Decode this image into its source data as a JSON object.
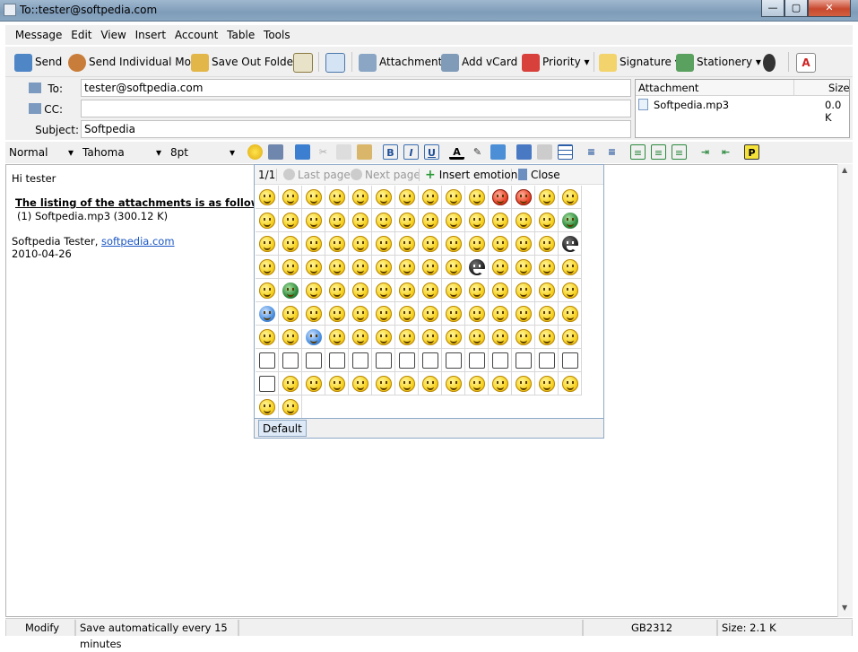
{
  "window": {
    "title": "To::tester@softpedia.com"
  },
  "menu": [
    "Message",
    "Edit",
    "View",
    "Insert",
    "Account",
    "Table",
    "Tools"
  ],
  "toolbar": {
    "send": "Send",
    "send_individual": "Send Individual Mode",
    "save_out": "Save Out Folder",
    "attachment": "Attachment",
    "add_vcard": "Add vCard",
    "priority": "Priority",
    "signature": "Signature",
    "stationery": "Stationery"
  },
  "header": {
    "to_label": "To:",
    "to_value": "tester@softpedia.com",
    "cc_label": "CC:",
    "cc_value": "",
    "subject_label": "Subject:",
    "subject_value": "Softpedia"
  },
  "attachments": {
    "col_name": "Attachment",
    "col_size": "Size",
    "rows": [
      {
        "name": "Softpedia.mp3",
        "size": "0.0 K"
      }
    ]
  },
  "format": {
    "style": "Normal",
    "font": "Tahoma",
    "size": "8pt",
    "bold": "B",
    "italic": "I",
    "underline": "U"
  },
  "body": {
    "greeting": "Hi tester",
    "listing_heading": "The listing of the attachments is as following:",
    "listing_item": "(1) Softpedia.mp3 (300.12 K)",
    "signature_name": "Softpedia Tester, ",
    "signature_link": "softpedia.com",
    "date": "2010-04-26"
  },
  "emoticons": {
    "page": "1/1",
    "last_page": "Last page",
    "next_page": "Next page",
    "insert": "Insert emotion",
    "close": "Close",
    "tab": "Default",
    "count": 128
  },
  "status": {
    "mode": "Modify",
    "autosave": "Save automatically every 15 minutes",
    "encoding": "GB2312",
    "size": "Size: 2.1 K"
  }
}
